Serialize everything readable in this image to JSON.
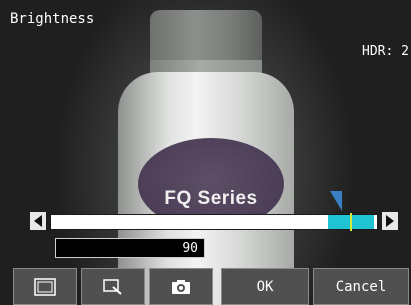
{
  "title": "Brightness",
  "hdr_label": "HDR: 2",
  "product_label": "FQ Series",
  "slider": {
    "value": "90",
    "range_start": 0.85,
    "range_end": 0.99,
    "indicator": 0.92
  },
  "icons": {
    "left": "left-arrow-icon",
    "right": "right-arrow-icon",
    "frame": "frame-icon",
    "zoom": "zoom-icon",
    "camera": "camera-icon"
  },
  "buttons": {
    "ok": "OK",
    "cancel": "Cancel"
  },
  "colors": {
    "range": "#20c3d2",
    "indicator": "#d6e83a",
    "pointer": "#3a7fc4",
    "button_bg": "#505050"
  }
}
